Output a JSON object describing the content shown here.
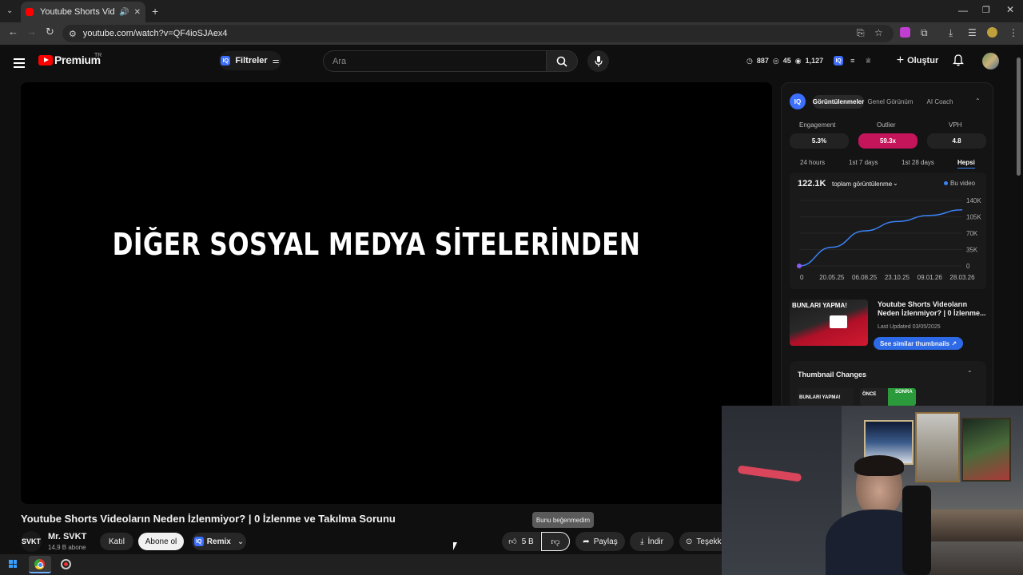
{
  "browser": {
    "tab_title": "Youtube Shorts Videoların İ",
    "url": "youtube.com/watch?v=QF4ioSJAex4"
  },
  "header": {
    "premium_label": "Premium",
    "region": "TR",
    "filter_label": "Filtreler",
    "search_placeholder": "Ara",
    "stats": {
      "a": "887",
      "b": "45",
      "c": "1,127"
    },
    "create_label": "Oluştur"
  },
  "video": {
    "overlay_text": "DİĞER SOSYAL MEDYA SİTELERİNDEN",
    "title": "Youtube Shorts Videoların Neden İzlenmiyor? | 0 İzlenme ve Takılma Sorunu",
    "channel_logo_text": "SVKT",
    "channel_name": "Mr. SVKT",
    "subscribers": "14,9 B abone",
    "join_label": "Katıl",
    "subscribe_label": "Abone ol",
    "remix_label": "Remix",
    "tooltip": "Bunu beğenmedim",
    "likes": "5 B",
    "share_label": "Paylaş",
    "download_label": "İndir",
    "thanks_label": "Teşekk"
  },
  "panel": {
    "tabs": [
      "Görüntülenmeler",
      "Genel Görünüm",
      "AI Coach"
    ],
    "metrics": [
      {
        "label": "Engagement",
        "value": "5.3%"
      },
      {
        "label": "Outlier",
        "value": "59.3x"
      },
      {
        "label": "VPH",
        "value": "4.8"
      }
    ],
    "ranges": [
      "24 hours",
      "1st 7 days",
      "1st 28 days",
      "Hepsi"
    ],
    "total_views": "122.1K",
    "views_dropdown": "toplam görüntülenme",
    "legend": "Bu video",
    "thumb_title": "Youtube Shorts Videoların Neden İzlenmiyor? | 0 İzlenme...",
    "thumb_text": "BUNLARI YAPMA!",
    "last_updated": "Last Updated 03/05/2025",
    "similar_label": "See similar thumbnails ↗",
    "thumbnail_changes": "Thumbnail Changes",
    "thumb_change_texts": [
      "BUNLARI YAPMA!",
      "ÖNCE",
      "SONRA"
    ]
  },
  "chart_data": {
    "type": "line",
    "x": [
      "0",
      "20.05.25",
      "06.08.25",
      "23.10.25",
      "09.01.26",
      "28.03.26"
    ],
    "y": [
      0,
      40000,
      75000,
      95000,
      108000,
      120000
    ],
    "series": [
      {
        "name": "Bu video",
        "values": [
          0,
          40000,
          75000,
          95000,
          108000,
          120000
        ]
      }
    ],
    "yticks": [
      "140K",
      "105K",
      "70K",
      "35K",
      "0"
    ],
    "ylim": [
      0,
      140000
    ],
    "colors": {
      "line": "#3b82f6"
    }
  },
  "colors": {
    "accent_red": "#ff0000",
    "outlier_pink": "#c4145a",
    "brand_blue": "#3d6fff"
  }
}
